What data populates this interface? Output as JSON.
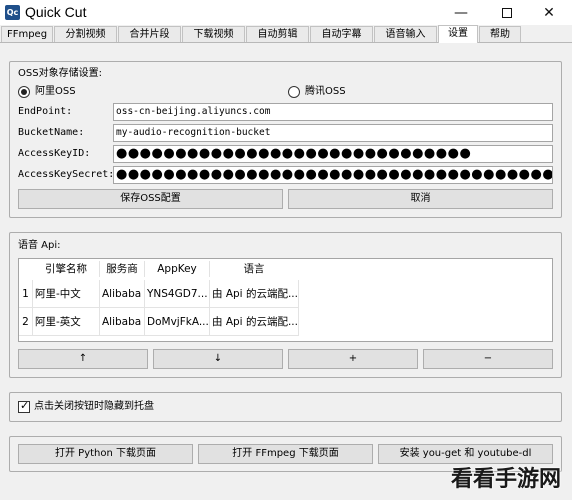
{
  "window": {
    "logo_text": "Qc",
    "title": "Quick Cut",
    "min_glyph": "—",
    "close_glyph": "✕"
  },
  "tabs": [
    "FFmpeg",
    "分割视频",
    "合并片段",
    "下载视频",
    "自动剪辑",
    "自动字幕",
    "语音输入",
    "设置",
    "帮助"
  ],
  "active_tab": "设置",
  "oss": {
    "group_title": "OSS对象存储设置:",
    "provider_aliyun": "阿里OSS",
    "provider_tencent": "腾讯OSS",
    "selected_provider": "阿里OSS",
    "endpoint_label": "EndPoint:",
    "endpoint_value": "oss-cn-beijing.aliyuncs.com",
    "bucket_label": "BucketName:",
    "bucket_value": "my-audio-recognition-bucket",
    "keyid_label": "AccessKeyID:",
    "keyid_value": "●●●●●●●●●●●●●●●●●●●●●●●●●●●●●●",
    "secret_label": "AccessKeySecret:",
    "secret_value": "●●●●●●●●●●●●●●●●●●●●●●●●●●●●●●●●●●●●●●●●●●●●●●",
    "save_button": "保存OSS配置",
    "cancel_button": "取消"
  },
  "api": {
    "group_title": "语音 Api:",
    "columns": [
      "引擎名称",
      "服务商",
      "AppKey",
      "语言"
    ],
    "rows": [
      {
        "num": "1",
        "name": "阿里-中文",
        "provider": "Alibaba",
        "appkey": "YNS4GD7...",
        "language": "由 Api 的云端配..."
      },
      {
        "num": "2",
        "name": "阿里-英文",
        "provider": "Alibaba",
        "appkey": "DoMvjFkA...",
        "language": "由 Api 的云端配..."
      }
    ],
    "up_button": "↑",
    "down_button": "↓",
    "add_button": "+",
    "remove_button": "−"
  },
  "tray": {
    "checkbox_label": "点击关闭按钮时隐藏到托盘",
    "checked": true,
    "check_glyph": "✓"
  },
  "links": {
    "python_button": "打开 Python 下载页面",
    "ffmpeg_button": "打开 FFmpeg 下载页面",
    "install_button": "安装 you-get 和 youtube-dl"
  },
  "watermark": "看看手游网"
}
